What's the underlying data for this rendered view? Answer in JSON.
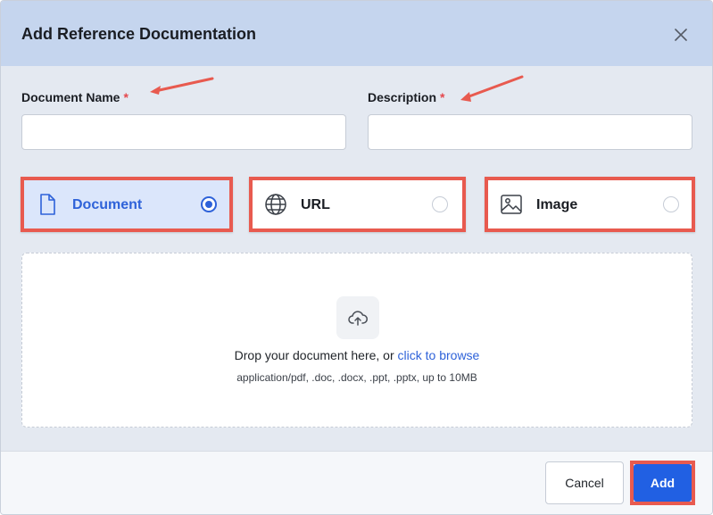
{
  "dialog": {
    "title": "Add Reference Documentation",
    "close_icon": "close-icon"
  },
  "form": {
    "document_name": {
      "label": "Document Name",
      "required_mark": "*",
      "value": "",
      "placeholder": ""
    },
    "description": {
      "label": "Description",
      "required_mark": "*",
      "value": "",
      "placeholder": ""
    }
  },
  "source_types": [
    {
      "label": "Document",
      "icon": "document-icon",
      "selected": true
    },
    {
      "label": "URL",
      "icon": "globe-icon",
      "selected": false
    },
    {
      "label": "Image",
      "icon": "image-icon",
      "selected": false
    }
  ],
  "upload": {
    "icon": "cloud-upload-icon",
    "prompt": "Drop your document here, or",
    "browse_link": "click to browse",
    "hint": "application/pdf, .doc, .docx, .ppt, .pptx, up to 10MB"
  },
  "footer": {
    "cancel_label": "Cancel",
    "add_label": "Add"
  },
  "colors": {
    "header_bg": "#c5d5ee",
    "body_bg": "#e4e9f1",
    "accent": "#2160e3",
    "selected_bg": "#dbe6fb",
    "required": "#e5484d",
    "annotation": "#e85a4f"
  }
}
